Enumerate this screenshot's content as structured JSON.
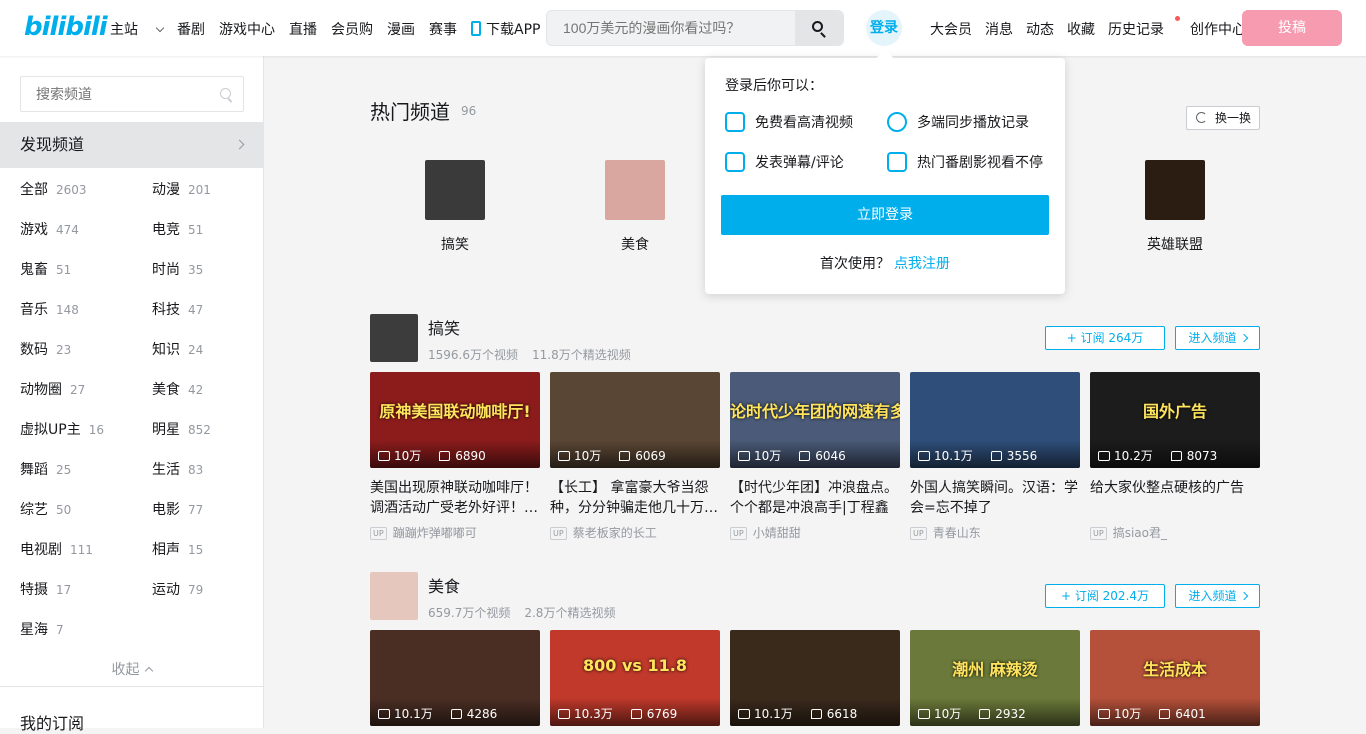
{
  "header": {
    "logo": "bilibili",
    "nav": [
      {
        "label": "主站",
        "dropdown": true
      },
      {
        "label": "番剧"
      },
      {
        "label": "游戏中心"
      },
      {
        "label": "直播"
      },
      {
        "label": "会员购"
      },
      {
        "label": "漫画"
      },
      {
        "label": "赛事"
      }
    ],
    "download": "下载APP",
    "search_placeholder": "100万美元的漫画你看过吗？",
    "login": "登录",
    "right_nav": [
      "大会员",
      "消息",
      "动态",
      "收藏",
      "历史记录",
      "创作中心"
    ],
    "post": "投稿"
  },
  "sidebar": {
    "search_placeholder": "搜索频道",
    "discover": "发现频道",
    "categories": [
      {
        "name": "全部",
        "count": "2603"
      },
      {
        "name": "动漫",
        "count": "201"
      },
      {
        "name": "游戏",
        "count": "474"
      },
      {
        "name": "电竞",
        "count": "51"
      },
      {
        "name": "鬼畜",
        "count": "51"
      },
      {
        "name": "时尚",
        "count": "35"
      },
      {
        "name": "音乐",
        "count": "148"
      },
      {
        "name": "科技",
        "count": "47"
      },
      {
        "name": "数码",
        "count": "23"
      },
      {
        "name": "知识",
        "count": "24"
      },
      {
        "name": "动物圈",
        "count": "27"
      },
      {
        "name": "美食",
        "count": "42"
      },
      {
        "name": "虚拟UP主",
        "count": "16"
      },
      {
        "name": "明星",
        "count": "852"
      },
      {
        "name": "舞蹈",
        "count": "25"
      },
      {
        "name": "生活",
        "count": "83"
      },
      {
        "name": "综艺",
        "count": "50"
      },
      {
        "name": "电影",
        "count": "77"
      },
      {
        "name": "电视剧",
        "count": "111"
      },
      {
        "name": "相声",
        "count": "15"
      },
      {
        "name": "特摄",
        "count": "17"
      },
      {
        "name": "运动",
        "count": "79"
      },
      {
        "name": "星海",
        "count": "7"
      }
    ],
    "collapse": "收起",
    "my_subscriptions": "我的订阅"
  },
  "hot": {
    "title": "热门频道",
    "count": "96",
    "change": "换一换",
    "channels": [
      {
        "name": "搞笑",
        "color": "#3a3a3a"
      },
      {
        "name": "美食",
        "color": "#d9a7a0"
      },
      {
        "name": "英雄联盟",
        "color": "#2b1d12"
      }
    ]
  },
  "channels": [
    {
      "name": "搞笑",
      "videos_count": "1596.6万个视频",
      "featured": "11.8万个精选视频",
      "subscribe": "订阅 264万",
      "enter": "进入频道",
      "avatar_color": "#3c3c3c",
      "videos": [
        {
          "title": "美国出现原神联动咖啡厅！调酒活动广受老外好评！外网疯狂",
          "up": "蹦蹦炸弹嘟嘟可",
          "plays": "10万",
          "likes": "6890",
          "color": "#8c1c1c",
          "caption": "原神美国联动咖啡厅!"
        },
        {
          "title": "【长工】 拿富豪大爷当怨种，分分钟骗走他几十万美元",
          "up": "蔡老板家的长工",
          "plays": "10万",
          "likes": "6069",
          "color": "#5a4634",
          "caption": ""
        },
        {
          "title": "【时代少年团】冲浪盘点。个个都是冲浪高手|丁程鑫",
          "up": "小婧甜甜",
          "plays": "10万",
          "likes": "6046",
          "color": "#4a5a78",
          "caption": "论时代少年团的网速有多快"
        },
        {
          "title": "外国人搞笑瞬间。汉语：学会=忘不掉了",
          "up": "青春山东",
          "plays": "10.1万",
          "likes": "3556",
          "color": "#2f4f7a",
          "caption": ""
        },
        {
          "title": "给大家伙整点硬核的广告",
          "up": "搞siao君_",
          "plays": "10.2万",
          "likes": "8073",
          "color": "#1c1c1c",
          "caption": "国外广告"
        }
      ]
    },
    {
      "name": "美食",
      "videos_count": "659.7万个视频",
      "featured": "2.8万个精选视频",
      "subscribe": "订阅 202.4万",
      "enter": "进入频道",
      "avatar_color": "#e6c7bd",
      "videos": [
        {
          "plays": "10.1万",
          "likes": "4286",
          "color": "#4a2e24",
          "caption": ""
        },
        {
          "plays": "10.3万",
          "likes": "6769",
          "color": "#c0392b",
          "caption": "800 vs 11.8"
        },
        {
          "plays": "10.1万",
          "likes": "6618",
          "color": "#3a2a1c",
          "caption": ""
        },
        {
          "plays": "10万",
          "likes": "2932",
          "color": "#6b7a3a",
          "caption": "潮州 麻辣烫"
        },
        {
          "plays": "10万",
          "likes": "6401",
          "color": "#b5503a",
          "caption": "生活成本"
        }
      ]
    }
  ],
  "popup": {
    "heading": "登录后你可以：",
    "items": [
      "免费看高清视频",
      "多端同步播放记录",
      "发表弹幕/评论",
      "热门番剧影视看不停"
    ],
    "button": "立即登录",
    "first_use": "首次使用？",
    "register": "点我注册"
  },
  "colors": {
    "accent": "#00aeec",
    "post": "#f69bb0"
  }
}
